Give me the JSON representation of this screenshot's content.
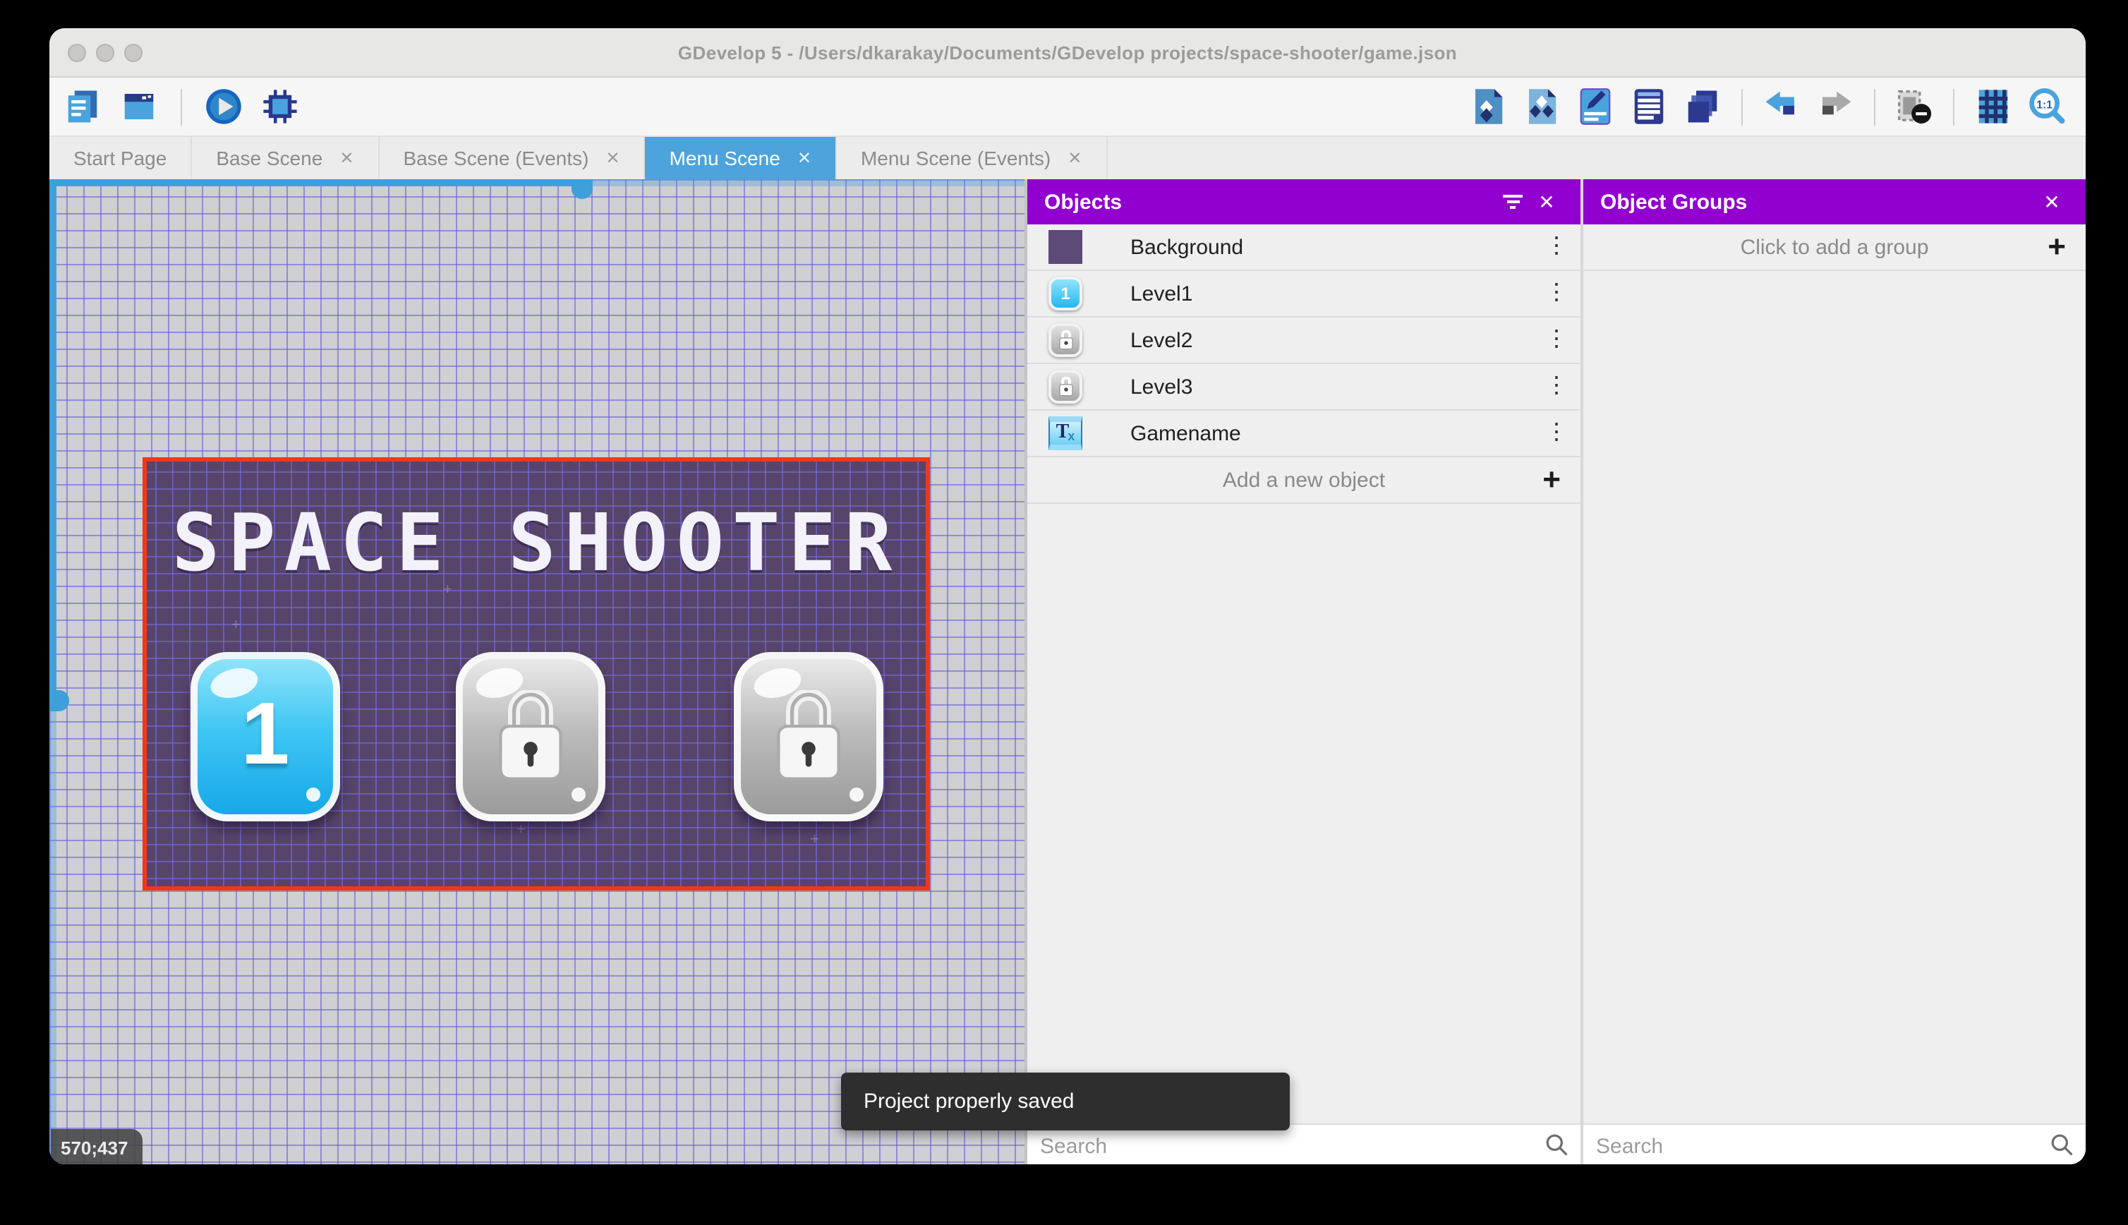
{
  "window": {
    "title": "GDevelop 5 - /Users/dkarakay/Documents/GDevelop projects/space-shooter/game.json"
  },
  "tabs": [
    {
      "label": "Start Page",
      "closable": false,
      "active": false
    },
    {
      "label": "Base Scene",
      "closable": true,
      "active": false
    },
    {
      "label": "Base Scene (Events)",
      "closable": true,
      "active": false
    },
    {
      "label": "Menu Scene",
      "closable": true,
      "active": true
    },
    {
      "label": "Menu Scene (Events)",
      "closable": true,
      "active": false
    }
  ],
  "toolbar": {
    "icons_left": [
      "project-manager",
      "preview-window",
      "play",
      "debug"
    ],
    "icons_right": [
      "objects-panel",
      "object-groups-panel",
      "properties",
      "instances-list",
      "layers",
      "undo",
      "redo",
      "toggle-mask",
      "grid",
      "zoom-1-1"
    ]
  },
  "ui": {
    "close": "✕",
    "kebab": "⋮",
    "plus": "+"
  },
  "objects_panel": {
    "title": "Objects",
    "items": [
      {
        "name": "Background",
        "icon": "background-swatch"
      },
      {
        "name": "Level1",
        "icon": "level1-button"
      },
      {
        "name": "Level2",
        "icon": "locked-button"
      },
      {
        "name": "Level3",
        "icon": "locked-button"
      },
      {
        "name": "Gamename",
        "icon": "text-object"
      }
    ],
    "add_label": "Add a new object",
    "search_placeholder": "Search"
  },
  "object_groups_panel": {
    "title": "Object Groups",
    "empty_label": "Click to add a group",
    "search_placeholder": "Search"
  },
  "scene": {
    "title": "SPACE SHOOTER",
    "level1_label": "1",
    "coordinate_badge": "570;437"
  },
  "toast": {
    "message": "Project properly saved"
  },
  "colors": {
    "header_purple": "#9100ce",
    "active_tab_blue": "#4da3dc",
    "selection_red": "#f23718",
    "scene_bg": "#57446a",
    "toolbar_blue": "#4aa3dd"
  }
}
